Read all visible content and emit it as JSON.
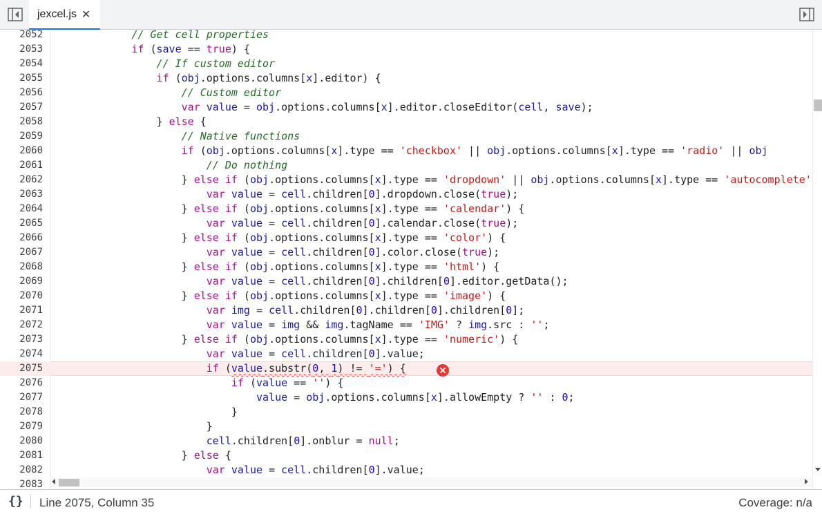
{
  "tab": {
    "file_name": "jexcel.js",
    "close_glyph": "✕"
  },
  "icons": {
    "left_toggle": "toggle-navigator-icon",
    "right_toggle": "toggle-debugger-icon",
    "error": "error-circle-icon",
    "format": "pretty-print-braces-icon"
  },
  "editor": {
    "active_line": "2075",
    "lines": [
      {
        "num": "2052"
      },
      {
        "num": "2053"
      },
      {
        "num": "2054"
      },
      {
        "num": "2055"
      },
      {
        "num": "2056"
      },
      {
        "num": "2057"
      },
      {
        "num": "2058"
      },
      {
        "num": "2059"
      },
      {
        "num": "2060"
      },
      {
        "num": "2061"
      },
      {
        "num": "2062"
      },
      {
        "num": "2063"
      },
      {
        "num": "2064"
      },
      {
        "num": "2065"
      },
      {
        "num": "2066"
      },
      {
        "num": "2067"
      },
      {
        "num": "2068"
      },
      {
        "num": "2069"
      },
      {
        "num": "2070"
      },
      {
        "num": "2071"
      },
      {
        "num": "2072"
      },
      {
        "num": "2073"
      },
      {
        "num": "2074"
      },
      {
        "num": "2075"
      },
      {
        "num": "2076"
      },
      {
        "num": "2077"
      },
      {
        "num": "2078"
      },
      {
        "num": "2079"
      },
      {
        "num": "2080"
      },
      {
        "num": "2081"
      },
      {
        "num": "2082"
      },
      {
        "num": "2083"
      }
    ],
    "tokens": {
      "l2052": {
        "a": "            ",
        "b": "// Get cell properties"
      },
      "l2053": {
        "a": "            ",
        "b": "if",
        "c": " (",
        "d": "save",
        "e": " == ",
        "f": "true",
        "g": ") {"
      },
      "l2054": {
        "a": "                ",
        "b": "// If custom editor"
      },
      "l2055": {
        "a": "                ",
        "b": "if",
        "c": " (",
        "d": "obj",
        "e": ".options.columns[",
        "f": "x",
        "g": "].editor) {"
      },
      "l2056": {
        "a": "                    ",
        "b": "// Custom editor"
      },
      "l2057": {
        "a": "                    ",
        "b": "var",
        "c": " ",
        "d": "value",
        "e": " = ",
        "f": "obj",
        "g": ".options.columns[",
        "h": "x",
        "i": "].editor.closeEditor(",
        "j": "cell",
        "k": ", ",
        "l": "save",
        "m": ");"
      },
      "l2058": {
        "a": "                ",
        "b": "} ",
        "c": "else",
        "d": " {"
      },
      "l2059": {
        "a": "                    ",
        "b": "// Native functions"
      },
      "l2060": {
        "a": "                    ",
        "b": "if",
        "c": " (",
        "d": "obj",
        "e": ".options.columns[",
        "f": "x",
        "g": "].type == ",
        "h": "'checkbox'",
        "i": " || ",
        "j": "obj",
        "k": ".options.columns[",
        "l": "x",
        "m": "].type == ",
        "n": "'radio'",
        "o": " || ",
        "p": "obj"
      },
      "l2061": {
        "a": "                        ",
        "b": "// Do nothing"
      },
      "l2062": {
        "a": "                    ",
        "b": "} ",
        "c": "else if",
        "d": " (",
        "e": "obj",
        "f": ".options.columns[",
        "g": "x",
        "h": "].type == ",
        "i": "'dropdown'",
        "j": " || ",
        "k": "obj",
        "l": ".options.columns[",
        "m": "x",
        "n": "].type == ",
        "o": "'autocomplete'"
      },
      "l2063": {
        "a": "                        ",
        "b": "var",
        "c": " ",
        "d": "value",
        "e": " = ",
        "f": "cell",
        "g": ".children[",
        "h": "0",
        "i": "].dropdown.close(",
        "j": "true",
        "k": ");"
      },
      "l2064": {
        "a": "                    ",
        "b": "} ",
        "c": "else if",
        "d": " (",
        "e": "obj",
        "f": ".options.columns[",
        "g": "x",
        "h": "].type == ",
        "i": "'calendar'",
        "j": ") {"
      },
      "l2065": {
        "a": "                        ",
        "b": "var",
        "c": " ",
        "d": "value",
        "e": " = ",
        "f": "cell",
        "g": ".children[",
        "h": "0",
        "i": "].calendar.close(",
        "j": "true",
        "k": ");"
      },
      "l2066": {
        "a": "                    ",
        "b": "} ",
        "c": "else if",
        "d": " (",
        "e": "obj",
        "f": ".options.columns[",
        "g": "x",
        "h": "].type == ",
        "i": "'color'",
        "j": ") {"
      },
      "l2067": {
        "a": "                        ",
        "b": "var",
        "c": " ",
        "d": "value",
        "e": " = ",
        "f": "cell",
        "g": ".children[",
        "h": "0",
        "i": "].color.close(",
        "j": "true",
        "k": ");"
      },
      "l2068": {
        "a": "                    ",
        "b": "} ",
        "c": "else if",
        "d": " (",
        "e": "obj",
        "f": ".options.columns[",
        "g": "x",
        "h": "].type == ",
        "i": "'html'",
        "j": ") {"
      },
      "l2069": {
        "a": "                        ",
        "b": "var",
        "c": " ",
        "d": "value",
        "e": " = ",
        "f": "cell",
        "g": ".children[",
        "h": "0",
        "i": "].children[",
        "j": "0",
        "k": "].editor.getData();"
      },
      "l2070": {
        "a": "                    ",
        "b": "} ",
        "c": "else if",
        "d": " (",
        "e": "obj",
        "f": ".options.columns[",
        "g": "x",
        "h": "].type == ",
        "i": "'image'",
        "j": ") {"
      },
      "l2071": {
        "a": "                        ",
        "b": "var",
        "c": " ",
        "d": "img",
        "e": " = ",
        "f": "cell",
        "g": ".children[",
        "h": "0",
        "i": "].children[",
        "j": "0",
        "k": "].children[",
        "l": "0",
        "m": "];"
      },
      "l2072": {
        "a": "                        ",
        "b": "var",
        "c": " ",
        "d": "value",
        "e": " = ",
        "f": "img",
        "g": " && ",
        "h": "img",
        "i": ".tagName == ",
        "j": "'IMG'",
        "k": " ? ",
        "l": "img",
        "m": ".src : ",
        "n": "''",
        "o": ";"
      },
      "l2073": {
        "a": "                    ",
        "b": "} ",
        "c": "else if",
        "d": " (",
        "e": "obj",
        "f": ".options.columns[",
        "g": "x",
        "h": "].type == ",
        "i": "'numeric'",
        "j": ") {"
      },
      "l2074": {
        "a": "                        ",
        "b": "var",
        "c": " ",
        "d": "value",
        "e": " = ",
        "f": "cell",
        "g": ".children[",
        "h": "0",
        "i": "].value;"
      },
      "l2075": {
        "a": "                        ",
        "b": "if",
        "c": " (",
        "d": "value",
        "e": ".substr(",
        "f": "0",
        "g": ", ",
        "h": "1",
        "i": ") != ",
        "j": "'='",
        "k": ") {"
      },
      "l2076": {
        "a": "                            ",
        "b": "if",
        "c": " (",
        "d": "value",
        "e": " == ",
        "f": "''",
        "g": ") {"
      },
      "l2077": {
        "a": "                                ",
        "b": "value",
        "c": " = ",
        "d": "obj",
        "e": ".options.columns[",
        "f": "x",
        "g": "].allowEmpty ? ",
        "h": "''",
        "i": " : ",
        "j": "0",
        "k": ";"
      },
      "l2078": {
        "a": "                            ",
        "b": "}"
      },
      "l2079": {
        "a": "                        ",
        "b": "}"
      },
      "l2080": {
        "a": "                        ",
        "b": "cell",
        "c": ".children[",
        "d": "0",
        "e": "].onblur = ",
        "f": "null",
        "g": ";"
      },
      "l2081": {
        "a": "                    ",
        "b": "} ",
        "c": "else",
        "d": " {"
      },
      "l2082": {
        "a": "                        ",
        "b": "var",
        "c": " ",
        "d": "value",
        "e": " = ",
        "f": "cell",
        "g": ".children[",
        "h": "0",
        "i": "].value;"
      },
      "l2083": {
        "a": ""
      }
    }
  },
  "status": {
    "position": "Line 2075, Column 35",
    "coverage": "Coverage: n/a",
    "braces": "{}"
  }
}
